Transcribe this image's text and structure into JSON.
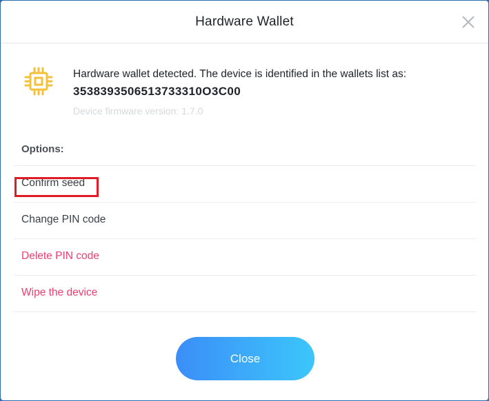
{
  "dialog": {
    "title": "Hardware Wallet",
    "close_icon": "close-icon"
  },
  "device": {
    "icon": "chip-icon",
    "detected_text": "Hardware wallet detected. The device is identified in the wallets list as:",
    "device_id": "3538393506513733310O3C00",
    "firmware_text": "Device firmware version: 1.7.0"
  },
  "options": {
    "heading": "Options:",
    "items": [
      {
        "label": "Confirm seed",
        "style": "normal"
      },
      {
        "label": "Change PIN code",
        "style": "normal"
      },
      {
        "label": "Delete PIN code",
        "style": "danger"
      },
      {
        "label": "Wipe the device",
        "style": "danger"
      }
    ]
  },
  "footer": {
    "close_label": "Close"
  },
  "colors": {
    "accent_gradient_start": "#3b8ef7",
    "accent_gradient_end": "#3cc6fb",
    "danger": "#ec3e6f",
    "chip_icon": "#f5c03b",
    "highlight": "#e01b24"
  }
}
